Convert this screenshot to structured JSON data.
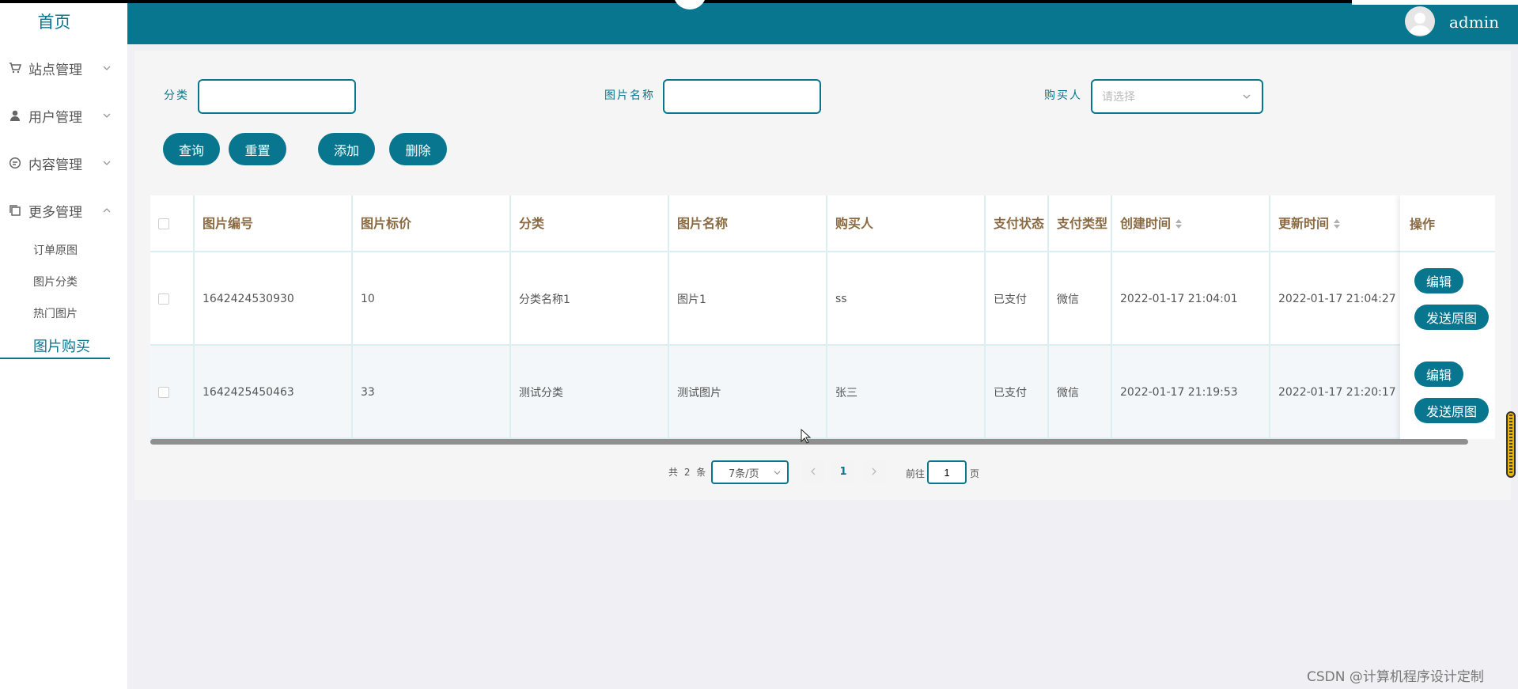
{
  "sidebar": {
    "home": "首页",
    "menus": [
      {
        "label": "站点管理",
        "icon": "shop-icon"
      },
      {
        "label": "用户管理",
        "icon": "user-icon"
      },
      {
        "label": "内容管理",
        "icon": "chat-icon"
      },
      {
        "label": "更多管理",
        "icon": "copy-icon"
      }
    ],
    "submenus": [
      "订单原图",
      "图片分类",
      "热门图片",
      "图片购买"
    ],
    "active": "图片购买"
  },
  "header": {
    "user": "admin",
    "color": "#08768f"
  },
  "search": {
    "category_label": "分类",
    "category_value": "",
    "name_label": "图片名称",
    "name_value": "",
    "buyer_label": "购买人",
    "buyer_placeholder": "请选择"
  },
  "actions": {
    "query": "查询",
    "reset": "重置",
    "add": "添加",
    "delete": "删除"
  },
  "table": {
    "columns": [
      "图片编号",
      "图片标价",
      "分类",
      "图片名称",
      "购买人",
      "支付状态",
      "支付类型",
      "创建时间",
      "更新时间",
      "操作"
    ],
    "rows": [
      {
        "id": "1642424530930",
        "price": "10",
        "category": "分类名称1",
        "name": "图片1",
        "buyer": "ss",
        "pay_status": "已支付",
        "pay_type": "微信",
        "created": "2022-01-17 21:04:01",
        "updated": "2022-01-17 21:04:27"
      },
      {
        "id": "1642425450463",
        "price": "33",
        "category": "测试分类",
        "name": "测试图片",
        "buyer": "张三",
        "pay_status": "已支付",
        "pay_type": "微信",
        "created": "2022-01-17 21:19:53",
        "updated": "2022-01-17 21:20:17"
      }
    ],
    "edit_label": "编辑",
    "send_label": "发送原图"
  },
  "pagination": {
    "total": "共 2 条",
    "page_size": "7条/页",
    "current": "1",
    "goto_prefix": "前往",
    "goto_value": "1",
    "goto_suffix": "页"
  },
  "watermark": "CSDN @计算机程序设计定制"
}
